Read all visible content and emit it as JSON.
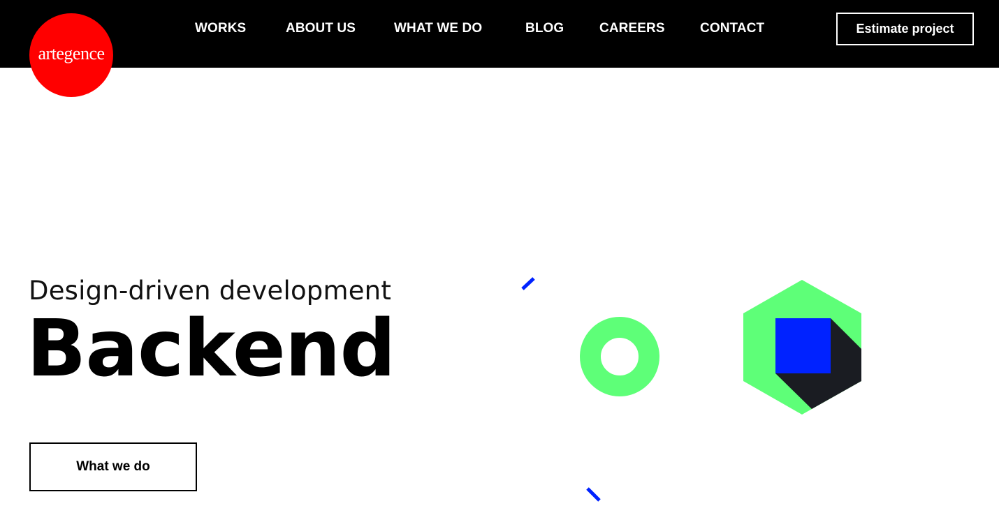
{
  "header": {
    "logo_text": "artegence",
    "nav": [
      {
        "label": "WORKS"
      },
      {
        "label": "ABOUT US"
      },
      {
        "label": "WHAT WE DO"
      },
      {
        "label": "BLOG"
      },
      {
        "label": "CAREERS"
      },
      {
        "label": "CONTACT"
      }
    ],
    "estimate_label": "Estimate project"
  },
  "hero": {
    "subtitle": "Design-driven development",
    "title": "Backend",
    "cta_label": "What we do"
  },
  "colors": {
    "header_bg": "#000000",
    "logo_red": "#ff0000",
    "accent_green": "#5eff78",
    "accent_blue": "#0022ff",
    "shadow_dark": "#1a1c22"
  },
  "icons": {
    "ring": "green-ring-icon",
    "hexagon": "hexagon-cube-icon",
    "dash_top": "blue-dash-icon",
    "dash_bottom": "blue-dash-icon"
  }
}
